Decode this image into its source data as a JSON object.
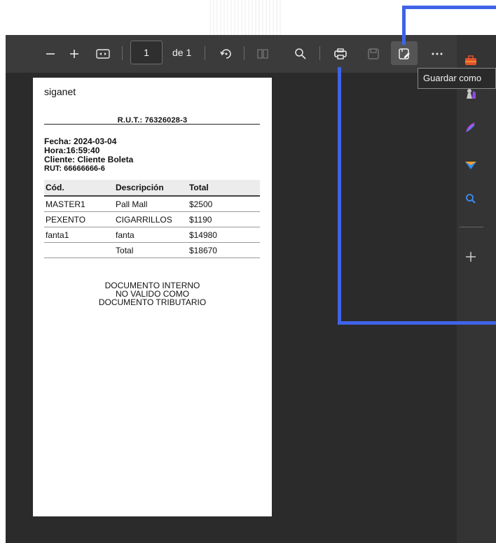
{
  "toolbar": {
    "page_number": "1",
    "page_of": "de 1",
    "icons": [
      "zoom-out-icon",
      "zoom-in-icon",
      "fit-width-icon",
      "rotate-icon",
      "two-page-icon",
      "search-icon",
      "print-icon",
      "save-icon",
      "save-as-icon",
      "more-icon"
    ]
  },
  "tooltip": {
    "text": "Guardar como"
  },
  "document": {
    "site": "siganet",
    "rut": "R.U.T.: 76326028-3",
    "fecha": "Fecha: 2024-03-04",
    "hora": "Hora:16:59:40",
    "cliente": "Cliente: Cliente Boleta",
    "rut_cliente": "RUT: 66666666-6",
    "table": {
      "headers": [
        "Cód.",
        "Descripción",
        "Total"
      ],
      "rows": [
        [
          "MASTER1",
          "Pall Mall",
          "$2500"
        ],
        [
          "PEXENTO",
          "CIGARRILLOS",
          "$1190"
        ],
        [
          "fanta1",
          "fanta",
          "$14980"
        ],
        [
          "",
          "Total",
          "$18670"
        ]
      ]
    },
    "note": [
      "DOCUMENTO INTERNO",
      "NO VALIDO COMO",
      "DOCUMENTO TRIBUTARIO"
    ]
  },
  "sidebar": {
    "icons": [
      "toolbox-icon",
      "chess-icon",
      "pen-icon",
      "send-icon",
      "search-icon",
      "add-icon"
    ]
  },
  "colors": {
    "annotation": "#3f63e8",
    "viewer_bg": "#2b2b2b",
    "toolbar_bg": "#3b3b3b"
  }
}
